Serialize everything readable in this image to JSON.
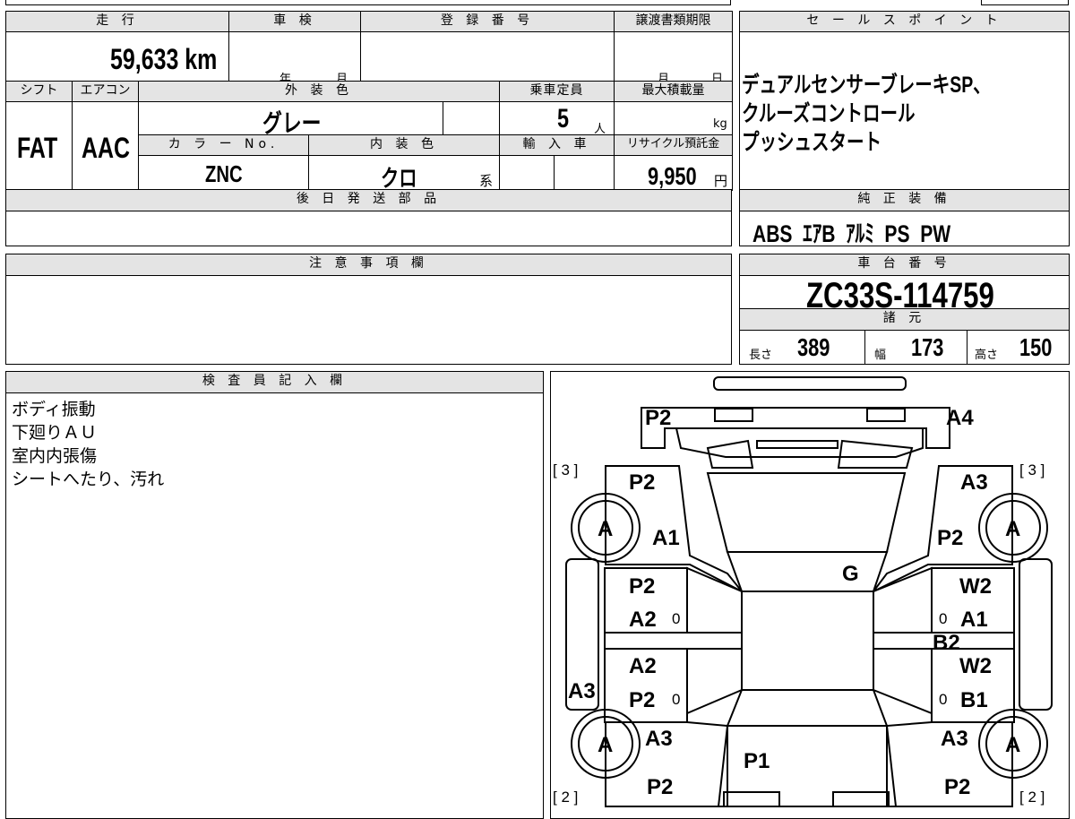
{
  "header": {
    "mileage_label": "走 行",
    "inspection_label": "車 検",
    "registration_label": "登 録 番 号",
    "transfer_deadline_label": "譲渡書類期限",
    "sales_points_label": "セ ー ル ス ポ イ ン ト"
  },
  "values": {
    "mileage": "59,633 km",
    "inspection_year_unit": "年",
    "inspection_month_unit": "月",
    "deadline_month_unit": "月",
    "deadline_day_unit": "日"
  },
  "row2": {
    "shift_label": "シフト",
    "aircon_label": "エアコン",
    "exterior_color_label": "外 装 色",
    "capacity_label": "乗車定員",
    "max_load_label": "最大積載量",
    "shift": "FAT",
    "aircon": "AAC",
    "exterior_color": "グレー",
    "capacity": "5",
    "capacity_unit": "人",
    "max_load_unit": "kg",
    "color_no_label": "カ ラ ー No.",
    "interior_color_label": "内 装 色",
    "import_label": "輸 入 車",
    "recycle_label": "リサイクル預託金",
    "color_no": "ZNC",
    "interior_color": "クロ",
    "interior_suffix": "系",
    "recycle_fee": "9,950",
    "recycle_unit": "円"
  },
  "sales_points": [
    "デュアルセンサーブレーキSP、",
    "クルーズコントロール",
    "プッシュスタート"
  ],
  "later_parts_label": "後 日 発 送 部 品",
  "equipment": {
    "label": "純 正 装 備",
    "items": "ABS  ｴｱB  ｱﾙﾐ  PS  PW"
  },
  "notes_label": "注 意 事 項 欄",
  "chassis": {
    "label": "車 台 番 号",
    "number": "ZC33S-114759",
    "specs_label": "諸 元",
    "length_label": "長さ",
    "length": "389",
    "width_label": "幅",
    "width": "173",
    "height_label": "高さ",
    "height": "150"
  },
  "inspector": {
    "label": "検 査 員 記 入 欄",
    "lines": [
      "ボディ振動",
      "下廻りＡＵ",
      "室内内張傷",
      "シートへたり、汚れ"
    ]
  },
  "diagram": {
    "bracket_left_top": "[ 3 ]",
    "bracket_right_top": "[ 3 ]",
    "bracket_left_bottom": "[ 2 ]",
    "bracket_right_bottom": "[ 2 ]",
    "tire_label": "A",
    "marks": {
      "front_left": "P2",
      "front_right": "A4",
      "fender_left_top": "P2",
      "fender_left_a1": "A1",
      "fender_right_top": "A3",
      "fender_right_p2": "P2",
      "windshield": "G",
      "door_fl_p2": "P2",
      "door_fl_a2": "A2",
      "door_fr_w2": "W2",
      "door_fr_a1": "A1",
      "pillar_right": "B2",
      "door_rl_a2": "A2",
      "door_rl_p2": "P2",
      "door_rr_w2": "W2",
      "door_rr_b1": "B1",
      "rocker_left": "A3",
      "qtr_left_a3": "A3",
      "qtr_left_p2": "P2",
      "qtr_right_a3": "A3",
      "qtr_right_p2": "P2",
      "roof_rear": "P1",
      "zero": "0"
    }
  }
}
